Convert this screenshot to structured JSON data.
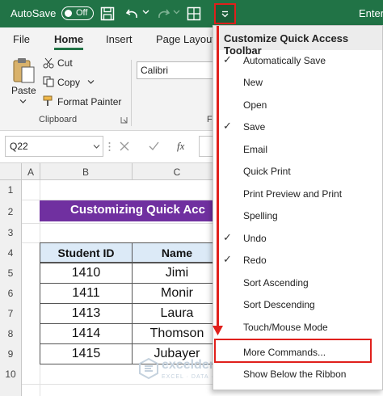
{
  "titlebar": {
    "autosave_label": "AutoSave",
    "autosave_state": "Off",
    "right_text": "Enter"
  },
  "ribbon": {
    "tabs": [
      "File",
      "Home",
      "Insert",
      "Page Layout"
    ],
    "paste_label": "Paste",
    "cut_label": "Cut",
    "copy_label": "Copy",
    "format_painter_label": "Format Painter",
    "clipboard_group": "Clipboard",
    "font_name": "Calibri",
    "font_group_letter": "F"
  },
  "formula_bar": {
    "name_box": "Q22",
    "fx": "fx"
  },
  "sheet": {
    "columns": [
      "A",
      "B",
      "C"
    ],
    "rows": [
      "1",
      "2",
      "3",
      "4",
      "5",
      "6",
      "7",
      "8",
      "9",
      "10"
    ],
    "banner": "Customizing Quick Acc",
    "headers": [
      "Student ID",
      "Name"
    ],
    "data": [
      [
        "1410",
        "Jimi"
      ],
      [
        "1411",
        "Monir"
      ],
      [
        "1413",
        "Laura"
      ],
      [
        "1414",
        "Thomson"
      ],
      [
        "1415",
        "Jubayer"
      ]
    ]
  },
  "menu": {
    "title": "Customize Quick Access Toolbar",
    "items": [
      {
        "label": "Automatically Save",
        "checked": true
      },
      {
        "label": "New",
        "checked": false
      },
      {
        "label": "Open",
        "checked": false
      },
      {
        "label": "Save",
        "checked": true
      },
      {
        "label": "Email",
        "checked": false
      },
      {
        "label": "Quick Print",
        "checked": false
      },
      {
        "label": "Print Preview and Print",
        "checked": false
      },
      {
        "label": "Spelling",
        "checked": false
      },
      {
        "label": "Undo",
        "checked": true
      },
      {
        "label": "Redo",
        "checked": true
      },
      {
        "label": "Sort Ascending",
        "checked": false
      },
      {
        "label": "Sort Descending",
        "checked": false
      },
      {
        "label": "Touch/Mouse Mode",
        "checked": false
      },
      {
        "label": "More Commands...",
        "checked": false
      },
      {
        "label": "Show Below the Ribbon",
        "checked": false
      }
    ],
    "check_glyph": "✓"
  },
  "watermark": {
    "brand": "exceldemy",
    "tagline": "EXCEL · DATA · BI"
  },
  "colors": {
    "excel_green": "#217346",
    "highlight_red": "#e0201c",
    "banner_purple": "#7030a0",
    "header_blue": "#dceaf7"
  },
  "icons": [
    "save-icon",
    "undo-icon",
    "redo-icon",
    "touch-mode-icon",
    "dropdown-icon",
    "paste-icon",
    "scissors-icon",
    "copy-icon",
    "format-painter-icon",
    "dialog-launcher-icon",
    "cancel-icon",
    "enter-icon"
  ]
}
